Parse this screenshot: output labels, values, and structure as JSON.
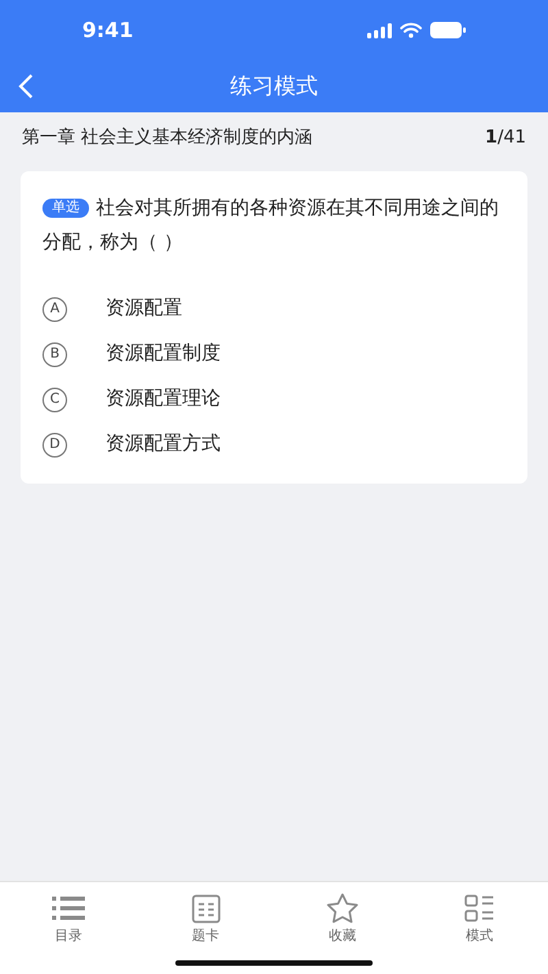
{
  "status_bar": {
    "time": "9:41"
  },
  "nav": {
    "title": "练习模式"
  },
  "chapter": {
    "title": "第一章 社会主义基本经济制度的内涵",
    "progress": "**1**/41"
  },
  "question": {
    "tag": "单选",
    "text": "社会对其所拥有的各种资源在其不同用途之间的分配，称为（ ）",
    "options": [
      {
        "letter": "A",
        "text": "资源配置"
      },
      {
        "letter": "B",
        "text": "资源配置制度"
      },
      {
        "letter": "C",
        "text": "资源配置理论"
      },
      {
        "letter": "D",
        "text": "资源配置方式"
      }
    ]
  },
  "tab_bar": [
    {
      "label": "目录",
      "kind": "list"
    },
    {
      "label": "题卡",
      "kind": "card"
    },
    {
      "label": "收藏",
      "kind": "star"
    },
    {
      "label": "模式",
      "kind": "mode"
    }
  ]
}
